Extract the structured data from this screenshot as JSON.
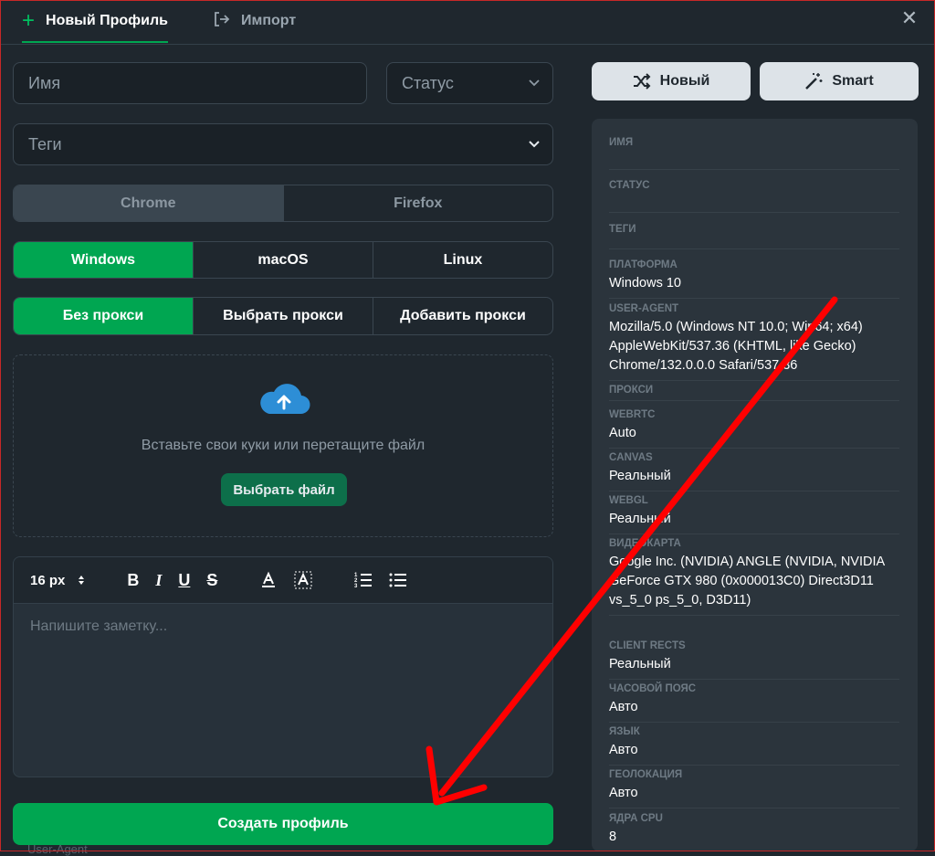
{
  "header": {
    "tab_new": "Новый Профиль",
    "tab_import": "Импорт",
    "close": "✕"
  },
  "form": {
    "name_placeholder": "Имя",
    "status_placeholder": "Статус",
    "tags_placeholder": "Теги",
    "browsers": [
      "Chrome",
      "Firefox"
    ],
    "platforms": [
      "Windows",
      "macOS",
      "Linux"
    ],
    "proxy_options": [
      "Без прокси",
      "Выбрать прокси",
      "Добавить прокси"
    ]
  },
  "cookies": {
    "drop_text": "Вставьте свои куки или перетащите файл",
    "choose_file": "Выбрать файл"
  },
  "editor": {
    "font_size": "16 px",
    "placeholder": "Напишите заметку..."
  },
  "actions": {
    "create_profile": "Создать профиль",
    "new_button": "Новый",
    "smart_button": "Smart",
    "ghost_label": "User-Agent"
  },
  "summary": {
    "name_label": "ИМЯ",
    "status_label": "СТАТУС",
    "tags_label": "ТЕГИ",
    "platform_label": "ПЛАТФОРМА",
    "platform": "Windows 10",
    "useragent_label": "USER-AGENT",
    "useragent": "Mozilla/5.0 (Windows NT 10.0; Win64; x64) AppleWebKit/537.36 (KHTML, like Gecko) Chrome/132.0.0.0 Safari/537.36",
    "proxy_label": "ПРОКСИ",
    "webrtc_label": "WEBRTC",
    "webrtc": "Auto",
    "canvas_label": "CANVAS",
    "canvas": "Реальный",
    "webgl_label": "WEBGL",
    "webgl": "Реальный",
    "gpu_label": "ВИДЕОКАРТА",
    "gpu": "Google Inc. (NVIDIA) ANGLE (NVIDIA, NVIDIA GeForce GTX 980 (0x000013C0) Direct3D11 vs_5_0 ps_5_0, D3D11)",
    "clientrects_label": "CLIENT RECTS",
    "clientrects": "Реальный",
    "timezone_label": "ЧАСОВОЙ ПОЯС",
    "timezone": "Авто",
    "language_label": "ЯЗЫК",
    "language": "Авто",
    "geo_label": "ГЕОЛОКАЦИЯ",
    "geo": "Авто",
    "cpu_label": "ЯДРА CPU",
    "cpu": "8"
  },
  "colors": {
    "accent": "#00a651",
    "annotation_arrow": "#ff0000"
  }
}
